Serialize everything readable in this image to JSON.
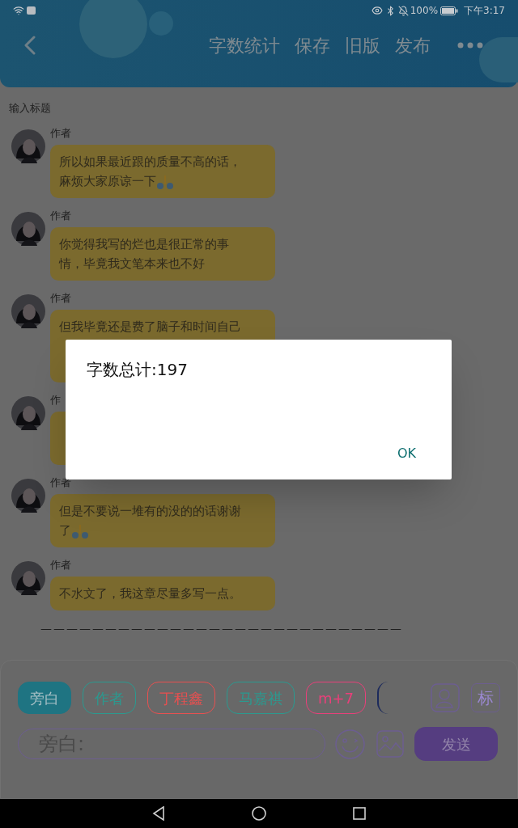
{
  "status_bar": {
    "battery": "100%",
    "time": "下午3:17"
  },
  "header": {
    "actions": [
      "字数统计",
      "保存",
      "旧版",
      "发布"
    ]
  },
  "title_field": {
    "placeholder": "输入标题"
  },
  "messages": [
    {
      "name": "作者",
      "lines": [
        "所以如果最近跟的质量不高的话，",
        "麻烦大家原谅一下"
      ],
      "pray_icon": true
    },
    {
      "name": "作者",
      "lines": [
        "你觉得我写的烂也是很正常的事",
        "情，毕竟我文笔本来也不好"
      ],
      "pray_icon": false
    },
    {
      "name": "作者",
      "kind": "covered",
      "lines": [
        "但我毕竟还是费了脑子和时间自己"
      ]
    },
    {
      "name": "作",
      "kind": "covered_short"
    },
    {
      "name": "作者",
      "lines": [
        "但是不要说一堆有的没的的话谢谢",
        "了"
      ],
      "pray_icon": true
    },
    {
      "name": "作者",
      "lines": [
        "不水文了，我这章尽量多写一点。"
      ],
      "pray_icon": false
    }
  ],
  "divider_text": "————————————————————————————",
  "chips": [
    {
      "kind": "chip",
      "label": "旁白",
      "color": "#1f7482",
      "selected": true
    },
    {
      "kind": "chip",
      "label": "作者",
      "color": "#2a9a90",
      "selected": false
    },
    {
      "kind": "chip",
      "label": "丁程鑫",
      "color": "#e85050",
      "selected": false
    },
    {
      "kind": "chip",
      "label": "马嘉祺",
      "color": "#2a9a90",
      "selected": false
    },
    {
      "kind": "chip",
      "label": "m+7",
      "color": "#e8407a",
      "selected": false
    },
    {
      "kind": "cut",
      "color": "#1c2a5c",
      "selected": false
    }
  ],
  "tag_button": "标",
  "input": {
    "value": "旁白:"
  },
  "send_button": "发送",
  "dialog": {
    "message": "字数总计:197",
    "button": "OK"
  }
}
